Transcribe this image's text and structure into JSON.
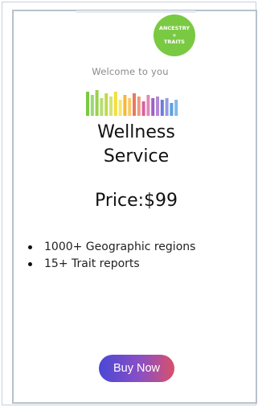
{
  "product": {
    "badge": {
      "line1": "ANCESTRY",
      "line2": "+",
      "line3": "TRAITS",
      "color": "#7ac943"
    },
    "image_caption": "Welcome to you",
    "title_line1": "Wellness",
    "title_line2": "Service",
    "price_label": "Price:",
    "price_value": "$99",
    "features": [
      "1000+ Geographic regions",
      "15+ Trait reports"
    ],
    "buy_label": "Buy Now"
  },
  "colors": {
    "card_border": "#b7c2cc",
    "button_gradient": [
      "#4a48d6",
      "#8b4fc4",
      "#d9506a"
    ],
    "dna_bars": [
      "#7ac943",
      "#9bd14d",
      "#c3d94a",
      "#f3df3a",
      "#f7b73a",
      "#e97a5a",
      "#d861a0",
      "#9a62c9",
      "#6f7bd6",
      "#5aa0e0"
    ]
  }
}
